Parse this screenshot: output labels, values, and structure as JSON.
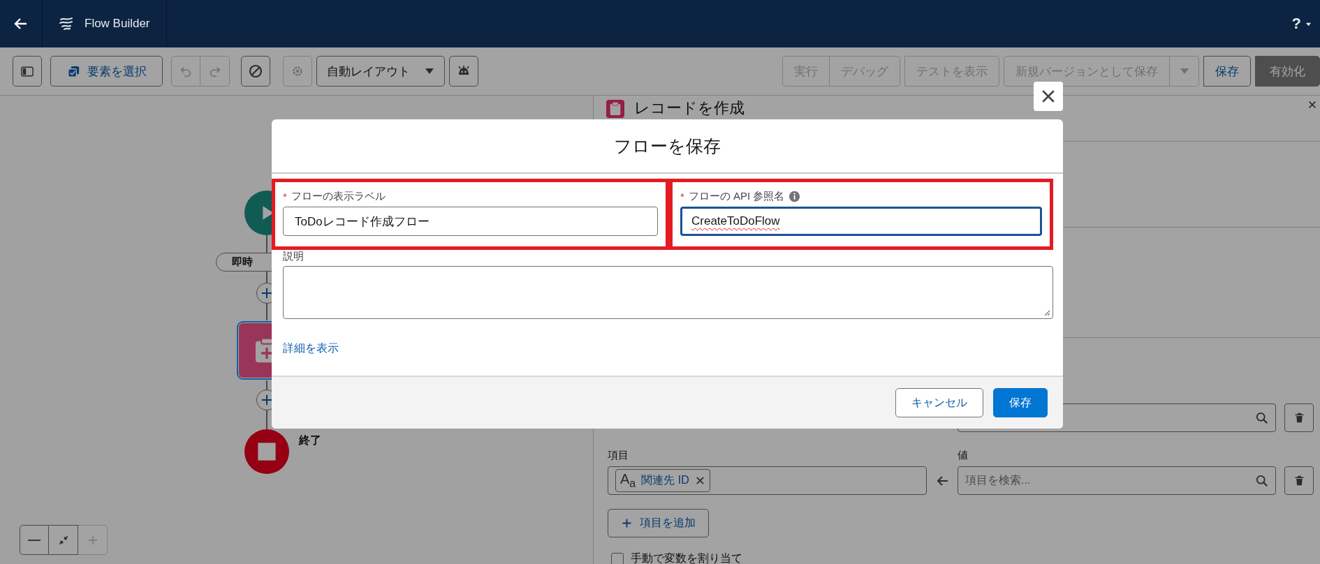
{
  "app_bar": {
    "title": "Flow Builder",
    "help": "?"
  },
  "toolbar": {
    "left": [
      {
        "kind": "toggle",
        "disabled": false
      },
      {
        "kind": "select",
        "label": "要素を選択",
        "disabled": false
      },
      {
        "kind": "undo",
        "disabled": true
      },
      {
        "kind": "redo",
        "disabled": true
      },
      {
        "kind": "clear",
        "disabled": false
      },
      {
        "kind": "settings",
        "disabled": true
      },
      {
        "kind": "dropdown",
        "label": "自動レイアウト",
        "disabled": false
      },
      {
        "kind": "debug",
        "disabled": false
      }
    ],
    "right": [
      {
        "buttons": [
          {
            "label": "実行",
            "disabled": true
          },
          {
            "label": "デバッグ",
            "disabled": true
          }
        ],
        "has_menu": false,
        "kind": "outline"
      },
      {
        "buttons": [
          {
            "label": "テストを表示",
            "disabled": true
          }
        ],
        "has_menu": false,
        "kind": "outline"
      },
      {
        "buttons": [
          {
            "label": "新規バージョンとして保存",
            "disabled": true
          }
        ],
        "has_menu": true,
        "kind": "outline"
      },
      {
        "buttons": [
          {
            "label": "保存",
            "disabled": false
          }
        ],
        "has_menu": false,
        "kind": "outline"
      },
      {
        "buttons": [
          {
            "label": "有効化",
            "disabled": true
          }
        ],
        "has_menu": false,
        "kind": "filled"
      }
    ]
  },
  "canvas": {
    "nodes": [
      {
        "kind": "start"
      },
      {
        "kind": "label",
        "label": "即時"
      },
      {
        "kind": "add"
      },
      {
        "kind": "record",
        "selected": true
      },
      {
        "kind": "add"
      },
      {
        "kind": "end",
        "label": "終了"
      }
    ],
    "zoom_controls": [
      {
        "kind": "zoom-out",
        "disabled": false
      },
      {
        "kind": "fit",
        "disabled": false
      },
      {
        "kind": "zoom-in",
        "disabled": true
      }
    ]
  },
  "panel": {
    "title": "レコードを作成",
    "assignments": [
      {
        "kind": "covered"
      },
      {
        "kind": "full",
        "field_label": "項目",
        "value_label": "値",
        "chip_icon": "A$_{a}$",
        "chip": "関連先 ID",
        "value_placeholder": "項目を検索..."
      }
    ],
    "add_button": "項目を追加",
    "manual_assign": {
      "label": "手動で変数を割り当て",
      "checked": false
    }
  },
  "modal": {
    "title": "フローを保存",
    "fields": [
      {
        "required_mark": "*",
        "label": "フローの表示ラベル",
        "info": false,
        "value": "ToDoレコード作成フロー",
        "focused": false,
        "spell_error": false,
        "highlighted": true
      },
      {
        "required_mark": "*",
        "label": "フローの API 参照名",
        "info": true,
        "value": "CreateToDoFlow",
        "focused": true,
        "spell_error": true,
        "highlighted": true
      }
    ],
    "description": {
      "label": "説明"
    },
    "link": "詳細を表示",
    "buttons": [
      {
        "label": "キャンセル",
        "kind": "neutral"
      },
      {
        "label": "保存",
        "kind": "brand"
      }
    ]
  }
}
